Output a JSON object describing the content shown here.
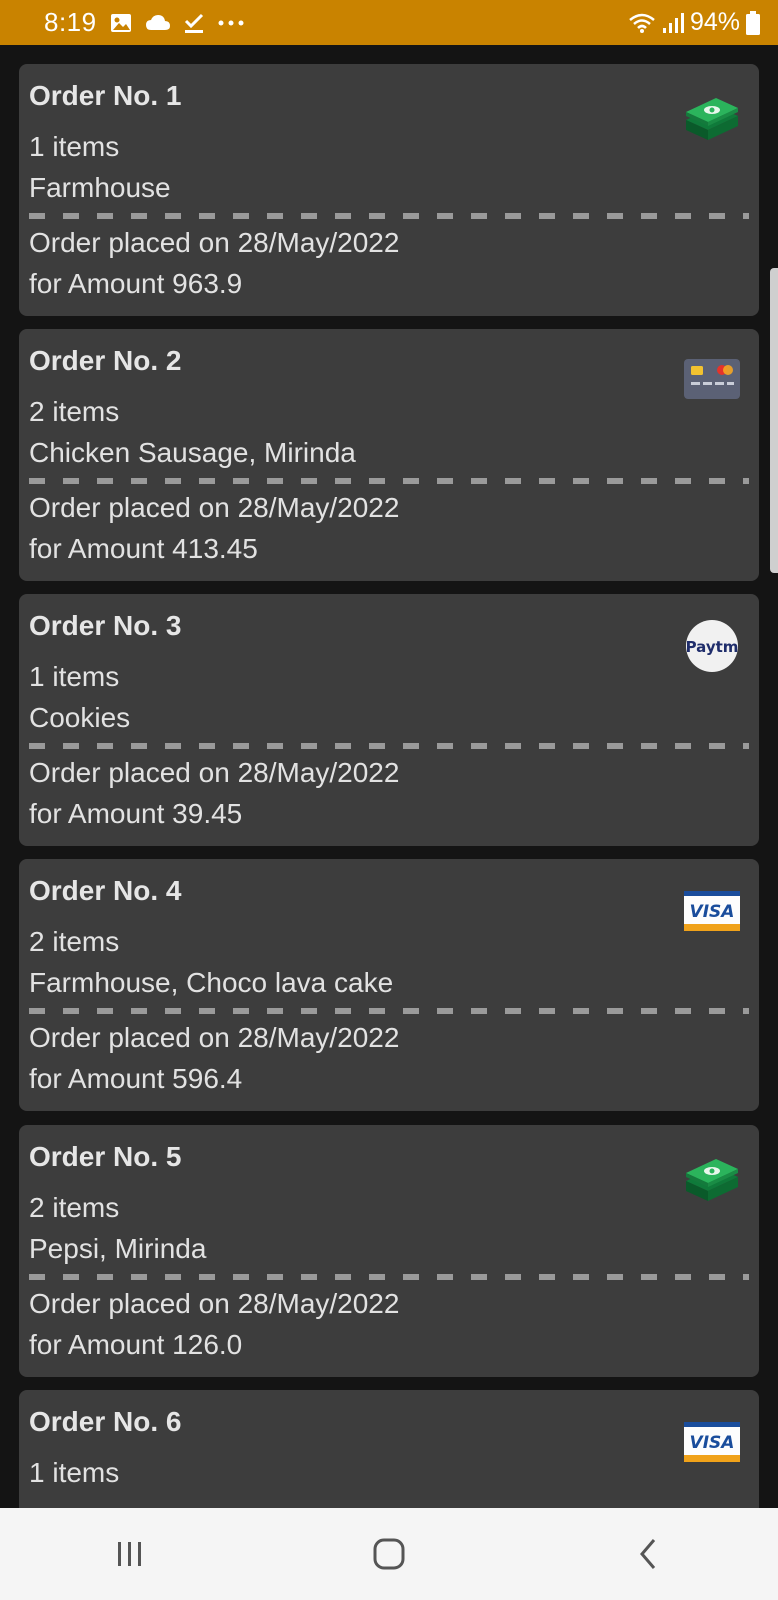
{
  "status_bar": {
    "time": "8:19",
    "battery": "94%",
    "icons": [
      "image-icon",
      "cloud-icon",
      "download-done-icon",
      "more-dots-icon",
      "wifi-icon",
      "signal-icon",
      "battery-icon"
    ]
  },
  "orders": [
    {
      "title": "Order No. 1",
      "items": "1 items",
      "names": "Farmhouse",
      "placed": "Order placed on 28/May/2022",
      "amount": "for Amount 963.9",
      "payment": "cash-icon"
    },
    {
      "title": "Order No. 2",
      "items": "2 items",
      "names": "Chicken Sausage, Mirinda",
      "placed": "Order placed on 28/May/2022",
      "amount": "for Amount 413.45",
      "payment": "card-icon"
    },
    {
      "title": "Order No. 3",
      "items": "1 items",
      "names": "Cookies",
      "placed": "Order placed on 28/May/2022",
      "amount": "for Amount 39.45",
      "payment": "paytm-icon"
    },
    {
      "title": "Order No. 4",
      "items": "2 items",
      "names": "Farmhouse, Choco lava cake",
      "placed": "Order placed on 28/May/2022",
      "amount": "for Amount 596.4",
      "payment": "visa-icon"
    },
    {
      "title": "Order No. 5",
      "items": "2 items",
      "names": "Pepsi, Mirinda",
      "placed": "Order placed on 28/May/2022",
      "amount": "for Amount 126.0",
      "payment": "cash-icon"
    },
    {
      "title": "Order No. 6",
      "items": "1 items",
      "names": "",
      "placed": "",
      "amount": "",
      "payment": "visa-icon"
    }
  ],
  "payment_labels": {
    "paytm": "Paytm",
    "visa": "VISA"
  },
  "colors": {
    "status_bar": "#c98300",
    "background": "#141414",
    "card": "#3d3d3d",
    "text": "#e2e2e2",
    "nav_bar": "#f5f5f5"
  },
  "nav_bar": {
    "buttons": [
      "recent-apps-button",
      "home-button",
      "back-button"
    ]
  }
}
